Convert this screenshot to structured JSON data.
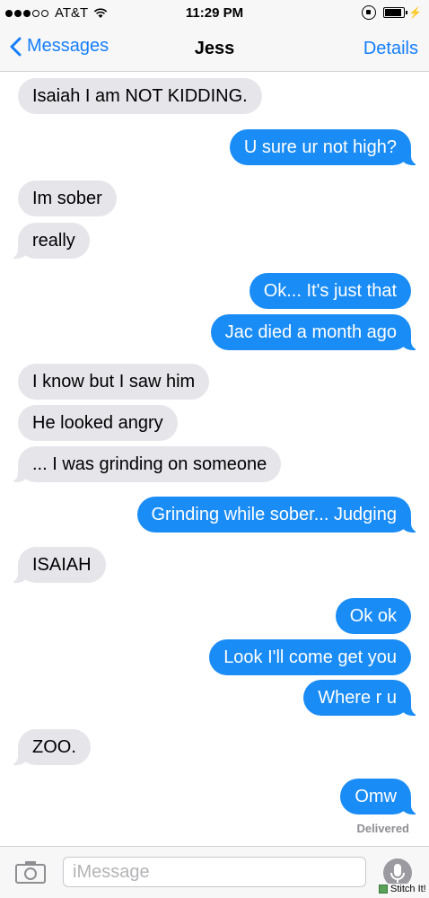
{
  "status_bar": {
    "carrier": "AT&T",
    "time": "11:29 PM",
    "icons": [
      "signal-dots",
      "wifi-icon",
      "rotation-lock-icon",
      "battery-icon",
      "charging-bolt-icon"
    ]
  },
  "nav": {
    "back_label": "Messages",
    "title": "Jess",
    "details_label": "Details"
  },
  "messages": [
    {
      "direction": "in",
      "text": "Isaiah I am NOT KIDDING."
    },
    {
      "direction": "out",
      "text": "U sure ur not high?"
    },
    {
      "direction": "in",
      "text": "Im sober"
    },
    {
      "direction": "in",
      "text": "really"
    },
    {
      "direction": "out",
      "text": "Ok... It's just that"
    },
    {
      "direction": "out",
      "text": "Jac died a month ago"
    },
    {
      "direction": "in",
      "text": "I know but I saw him"
    },
    {
      "direction": "in",
      "text": "He looked angry"
    },
    {
      "direction": "in",
      "text": "... I was grinding on someone"
    },
    {
      "direction": "out",
      "text": "Grinding while sober... Judging"
    },
    {
      "direction": "in",
      "text": "ISAIAH"
    },
    {
      "direction": "out",
      "text": "Ok ok"
    },
    {
      "direction": "out",
      "text": "Look I'll come get you"
    },
    {
      "direction": "out",
      "text": "Where r u"
    },
    {
      "direction": "in",
      "text": "ZOO."
    },
    {
      "direction": "out",
      "text": "Omw"
    }
  ],
  "delivery_status": "Delivered",
  "input": {
    "placeholder": "iMessage",
    "value": ""
  },
  "watermark": "Stitch It!",
  "colors": {
    "outgoing_bubble": "#1a8cf5",
    "incoming_bubble": "#e5e5ea",
    "accent": "#157efb"
  }
}
